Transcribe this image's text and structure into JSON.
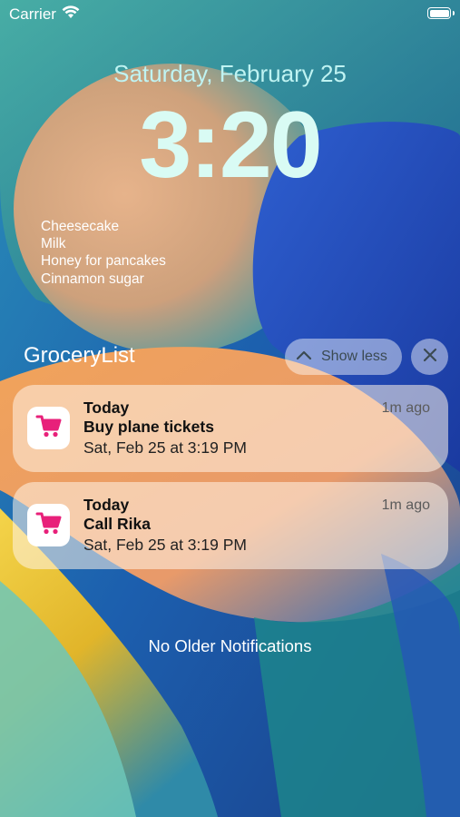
{
  "status_bar": {
    "carrier": "Carrier"
  },
  "lock_screen": {
    "date": "Saturday, February 25",
    "time": "3:20",
    "widget_lines": [
      "Cheesecake",
      "Milk",
      "Honey for pancakes",
      "Cinnamon sugar"
    ]
  },
  "notification_group": {
    "app_name": "GroceryList",
    "show_less_label": "Show less",
    "app_icon": "cart-icon",
    "accent_color": "#e8207a",
    "notifications": [
      {
        "title": "Today",
        "body": "Buy plane tickets",
        "subtitle": "Sat, Feb 25 at 3:19 PM",
        "time_ago": "1m ago"
      },
      {
        "title": "Today",
        "body": "Call Rika",
        "subtitle": "Sat, Feb 25 at 3:19 PM",
        "time_ago": "1m ago"
      }
    ]
  },
  "footer": {
    "no_older_text": "No Older Notifications"
  }
}
